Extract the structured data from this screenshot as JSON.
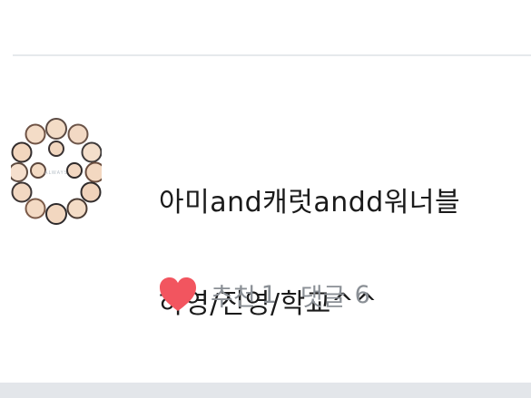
{
  "post": {
    "title_line1": "아미and캐럿andd워너블",
    "title_line2": "하영/진영/학교^^",
    "thumbnail_text": "ALWAYS",
    "recommend_label": "추천",
    "recommend_count": "1",
    "comment_label": "댓글",
    "comment_count": "6",
    "heart_color": "#f2555f"
  }
}
